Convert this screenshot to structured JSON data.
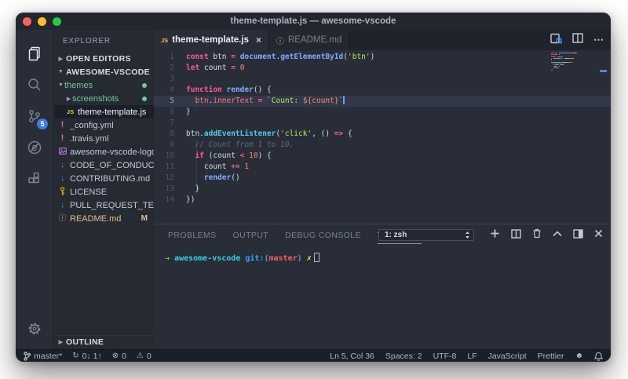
{
  "window": {
    "title": "theme-template.js — awesome-vscode"
  },
  "colors": {
    "accent_blue": "#82aaff",
    "keyword_pink": "#ff5c93",
    "string_green": "#b3e860",
    "number_orange": "#f78c6c",
    "cyan": "#50cbe0",
    "untracked_green": "#73c991",
    "modified_gold": "#e2c08d",
    "badge_blue": "#3a7fe0",
    "editor_bg": "#282d38",
    "sidebar_bg": "#262a33",
    "statusbar_bg": "#1b1f27"
  },
  "activity_bar": {
    "items": [
      {
        "name": "explorer",
        "active": true
      },
      {
        "name": "search",
        "active": false
      },
      {
        "name": "source-control",
        "active": false,
        "badge": "5"
      },
      {
        "name": "debug",
        "active": false
      },
      {
        "name": "extensions",
        "active": false
      }
    ],
    "settings": "gear"
  },
  "sidebar": {
    "title": "EXPLORER",
    "open_editors_label": "OPEN EDITORS",
    "root_label": "AWESOME-VSCODE",
    "outline_label": "OUTLINE",
    "tree": [
      {
        "label": "themes",
        "kind": "folder",
        "arrow": "expanded",
        "color": "green",
        "badge": "dot",
        "indent": 1
      },
      {
        "label": "screenshots",
        "kind": "folder",
        "arrow": "collapsed",
        "color": "green",
        "badge": "dot",
        "indent": 2
      },
      {
        "label": "theme-template.js",
        "icon": "js",
        "selected": true,
        "indent": 2
      },
      {
        "label": "_config.yml",
        "icon": "yml",
        "indent": 1
      },
      {
        "label": ".travis.yml",
        "icon": "yml",
        "indent": 1
      },
      {
        "label": "awesome-vscode-logo..",
        "icon": "image",
        "indent": 1
      },
      {
        "label": "CODE_OF_CONDUCT....",
        "icon": "md",
        "indent": 1
      },
      {
        "label": "CONTRIBUTING.md",
        "icon": "md",
        "indent": 1
      },
      {
        "label": "LICENSE",
        "icon": "key",
        "indent": 1
      },
      {
        "label": "PULL_REQUEST_TEMP..",
        "icon": "md",
        "indent": 1
      },
      {
        "label": "README.md",
        "icon": "info",
        "color": "gold",
        "badge": "M",
        "indent": 1
      }
    ]
  },
  "editor": {
    "tabs": [
      {
        "label": "theme-template.js",
        "icon": "js",
        "active": true,
        "close": "×"
      },
      {
        "label": "README.md",
        "icon": "info",
        "active": false
      }
    ],
    "actions": [
      "open-preview",
      "split-editor",
      "more-actions"
    ],
    "cursor": {
      "line": 5,
      "col": 36
    },
    "code": [
      {
        "n": "1",
        "tokens": [
          [
            "kw",
            "const"
          ],
          [
            "pl",
            " btn "
          ],
          [
            "op",
            "="
          ],
          [
            "pl",
            " "
          ],
          [
            "fn",
            "document"
          ],
          [
            "pl",
            "."
          ],
          [
            "fn",
            "getElementById"
          ],
          [
            "pl",
            "("
          ],
          [
            "str",
            "'btn'"
          ],
          [
            "pl",
            ")"
          ]
        ]
      },
      {
        "n": "2",
        "tokens": [
          [
            "kw",
            "let"
          ],
          [
            "pl",
            " count "
          ],
          [
            "op",
            "="
          ],
          [
            "pl",
            " "
          ],
          [
            "num",
            "0"
          ]
        ]
      },
      {
        "n": "3",
        "tokens": []
      },
      {
        "n": "4",
        "tokens": [
          [
            "kw",
            "function"
          ],
          [
            "pl",
            " "
          ],
          [
            "fn",
            "render"
          ],
          [
            "pl",
            "() {"
          ]
        ]
      },
      {
        "n": "5",
        "current": true,
        "cursor": true,
        "tokens": [
          [
            "pl",
            "  "
          ],
          [
            "red",
            "btn"
          ],
          [
            "pl",
            "."
          ],
          [
            "red",
            "innerText"
          ],
          [
            "pl",
            " "
          ],
          [
            "op",
            "="
          ],
          [
            "pl",
            " "
          ],
          [
            "str",
            "`Count: "
          ],
          [
            "num",
            "${count}"
          ],
          [
            "str",
            "`"
          ]
        ]
      },
      {
        "n": "6",
        "tokens": [
          [
            "pl",
            "}"
          ]
        ]
      },
      {
        "n": "7",
        "tokens": []
      },
      {
        "n": "8",
        "tokens": [
          [
            "pl",
            "btn."
          ],
          [
            "cy",
            "addEventListener"
          ],
          [
            "pl",
            "("
          ],
          [
            "str",
            "'click'"
          ],
          [
            "pl",
            ", () "
          ],
          [
            "op",
            "=>"
          ],
          [
            "pl",
            " {"
          ]
        ]
      },
      {
        "n": "9",
        "tokens": [
          [
            "cm",
            "  // Count from 1 to 10."
          ]
        ]
      },
      {
        "n": "10",
        "tokens": [
          [
            "pl",
            "  "
          ],
          [
            "kw",
            "if"
          ],
          [
            "pl",
            " (count "
          ],
          [
            "op",
            "<"
          ],
          [
            "pl",
            " "
          ],
          [
            "num",
            "10"
          ],
          [
            "pl",
            ") {"
          ]
        ]
      },
      {
        "n": "11",
        "tokens": [
          [
            "pl",
            "    count "
          ],
          [
            "op",
            "+="
          ],
          [
            "pl",
            " "
          ],
          [
            "num",
            "1"
          ]
        ]
      },
      {
        "n": "12",
        "tokens": [
          [
            "pl",
            "    "
          ],
          [
            "fn",
            "render"
          ],
          [
            "pl",
            "()"
          ]
        ]
      },
      {
        "n": "13",
        "tokens": [
          [
            "pl",
            "  }"
          ]
        ]
      },
      {
        "n": "14",
        "tokens": [
          [
            "pl",
            "})"
          ]
        ]
      }
    ]
  },
  "panel": {
    "tabs": [
      {
        "label": "PROBLEMS",
        "active": false
      },
      {
        "label": "OUTPUT",
        "active": false
      },
      {
        "label": "DEBUG CONSOLE",
        "active": false
      },
      {
        "label": "TERMINAL",
        "active": true
      }
    ],
    "shell_select": "1: zsh",
    "actions": [
      "new-terminal",
      "split-terminal",
      "kill-terminal",
      "maximize-panel",
      "toggle-panel",
      "close-panel"
    ],
    "prompt": [
      [
        "arrow",
        "→"
      ],
      [
        "pl",
        "  "
      ],
      [
        "dir",
        "awesome-vscode"
      ],
      [
        "pl",
        " "
      ],
      [
        "git",
        "git:("
      ],
      [
        "branch",
        "master"
      ],
      [
        "git",
        ")"
      ],
      [
        "pl",
        " "
      ],
      [
        "dirty",
        "✗"
      ]
    ]
  },
  "status_bar": {
    "left": [
      {
        "icon": "branch",
        "label": "master*"
      },
      {
        "icon": "sync",
        "label": "0↓ 1↑"
      },
      {
        "icon": "error",
        "label": "0"
      },
      {
        "icon": "warning",
        "label": "0"
      }
    ],
    "right": [
      {
        "label": "Ln 5, Col 36"
      },
      {
        "label": "Spaces: 2"
      },
      {
        "label": "UTF-8"
      },
      {
        "label": "LF"
      },
      {
        "label": "JavaScript"
      },
      {
        "label": "Prettier"
      },
      {
        "icon": "smiley",
        "label": ""
      },
      {
        "icon": "bell",
        "label": ""
      }
    ]
  }
}
